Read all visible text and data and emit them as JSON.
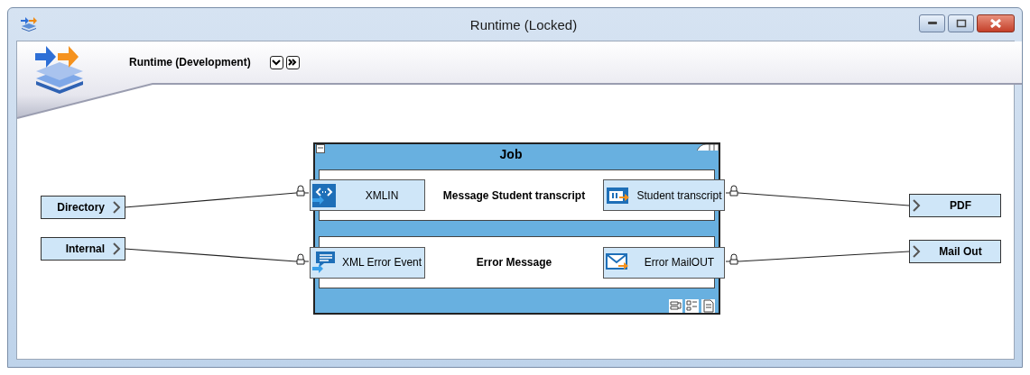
{
  "window": {
    "title": "Runtime (Locked)"
  },
  "header": {
    "title": "Runtime (Development)"
  },
  "diagram": {
    "inputs": [
      {
        "label": "Directory"
      },
      {
        "label": "Internal"
      }
    ],
    "job": {
      "title": "Job",
      "lanes": [
        {
          "source": {
            "label": "XMLIN",
            "kind": "xml"
          },
          "message": "Message Student transcript",
          "target": {
            "label": "Student transcript",
            "kind": "document"
          }
        },
        {
          "source": {
            "label": "XML Error Event",
            "kind": "event"
          },
          "message": "Error Message",
          "target": {
            "label": "Error MailOUT",
            "kind": "mail"
          }
        }
      ]
    },
    "outputs": [
      {
        "label": "PDF"
      },
      {
        "label": "Mail Out"
      }
    ]
  }
}
